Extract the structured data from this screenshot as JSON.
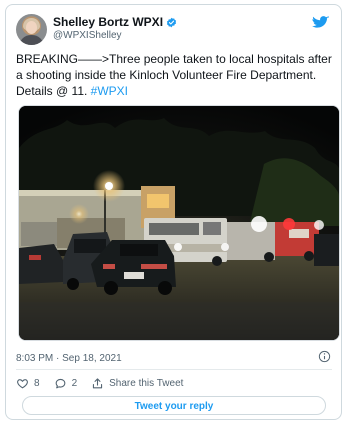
{
  "author": {
    "display_name": "Shelley Bortz WPXI",
    "handle": "@WPXIShelley"
  },
  "tweet": {
    "text_prefix": "BREAKING——>Three people taken to local hospitals after a shooting inside the Kinloch Volunteer Fire Department. Details @ 11. ",
    "hashtag": "#WPXI",
    "timestamp": "8:03 PM · Sep 18, 2021"
  },
  "actions": {
    "likes": "8",
    "replies": "2",
    "share_label": "Share this Tweet",
    "reply_button": "Tweet your reply"
  },
  "colors": {
    "accent": "#1d9bf0",
    "text": "#0f1419",
    "secondary": "#536471"
  },
  "icons": [
    "verified-badge-icon",
    "twitter-bird-icon",
    "info-icon",
    "heart-icon",
    "reply-bubble-icon",
    "share-icon"
  ]
}
